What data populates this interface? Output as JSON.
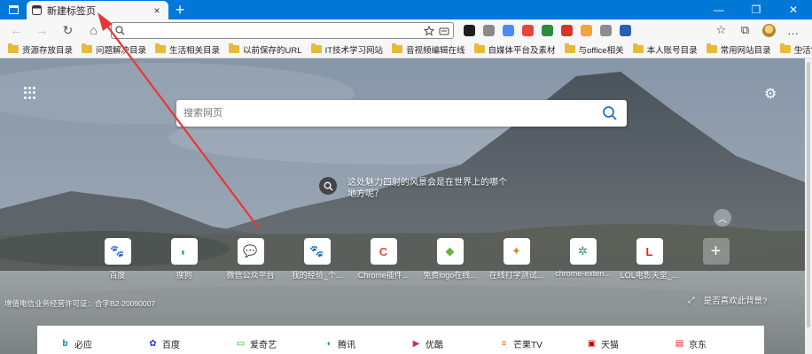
{
  "window": {
    "tab_title": "新建标签页",
    "tab_close": "×",
    "new_tab": "+",
    "controls": {
      "minimize": "—",
      "restore": "❐",
      "close": "✕"
    }
  },
  "toolbar": {
    "back": "←",
    "forward": "→",
    "refresh": "↻",
    "home": "⌂",
    "address_value": "",
    "address_placeholder": ""
  },
  "extensions": [
    "ext-1",
    "ext-2",
    "ext-3",
    "ext-4",
    "ext-5",
    "ext-6",
    "ext-7",
    "ext-8",
    "ext-9"
  ],
  "extension_colors": [
    "#1e1e1e",
    "#8a8a8a",
    "#4c8bf5",
    "#e8453c",
    "#2e8b3d",
    "#d9342b",
    "#f2a33a",
    "#8c8c8c",
    "#2a5fb0"
  ],
  "right_tools": {
    "favorites": "☆",
    "collections": "⧉",
    "more": "…"
  },
  "bookmarks": [
    "资源存放目录",
    "问题解决目录",
    "生活相关目录",
    "以前保存的URL",
    "IT技术学习网站",
    "音视频编辑在线",
    "自媒体平台及素材",
    "与office相关",
    "本人账号目录",
    "常用网站目录",
    "生活常用分类"
  ],
  "bookmarks_more": "›",
  "newtab": {
    "search_placeholder": "搜索网页",
    "image_caption": "这处魅力四射的风景会是在世界上的哪个地方呢？",
    "tiles": [
      {
        "label": "百度",
        "glyph": "🐾",
        "color": "#2932e1"
      },
      {
        "label": "搜狗",
        "glyph": "◐",
        "color": "#2fb55d"
      },
      {
        "label": "微信公众平台",
        "glyph": "💬",
        "color": "#2dc100"
      },
      {
        "label": "我的经验_个...",
        "glyph": "🐾",
        "color": "#2932e1"
      },
      {
        "label": "Chrome插件...",
        "glyph": "C",
        "color": "#e8453c"
      },
      {
        "label": "免费logo在线...",
        "glyph": "◆",
        "color": "#6cb33e"
      },
      {
        "label": "在线打字测试...",
        "glyph": "✦",
        "color": "#d98a2b"
      },
      {
        "label": "chrome-exten...",
        "glyph": "✲",
        "color": "#2f8a6b"
      },
      {
        "label": "LOL电影天堂_...",
        "glyph": "L",
        "color": "#d9262b"
      }
    ],
    "add_tile": "+",
    "footer_license": "增值电信业务经营许可证：合字B2-20090007",
    "footer_question": "是否喜欢此背景?",
    "quicklinks": [
      {
        "label": "必应",
        "glyph": "b",
        "color": "#00809d"
      },
      {
        "label": "百度",
        "glyph": "✿",
        "color": "#2932e1"
      },
      {
        "label": "爱奇艺",
        "glyph": "▭",
        "color": "#00be06"
      },
      {
        "label": "腾讯",
        "glyph": "◖",
        "color": "#0fa339"
      },
      {
        "label": "优酷",
        "glyph": "▶",
        "color": "#d4237a"
      },
      {
        "label": "芒果TV",
        "glyph": "≡",
        "color": "#ff5f00"
      },
      {
        "label": "天猫",
        "glyph": "▣",
        "color": "#c40000"
      },
      {
        "label": "京东",
        "glyph": "▤",
        "color": "#e1251b"
      }
    ]
  },
  "colors": {
    "titlebar": "#0078d7",
    "toolbar": "#f7f7f7",
    "folder": "#e9b93b",
    "arrow": "#e43a36"
  }
}
